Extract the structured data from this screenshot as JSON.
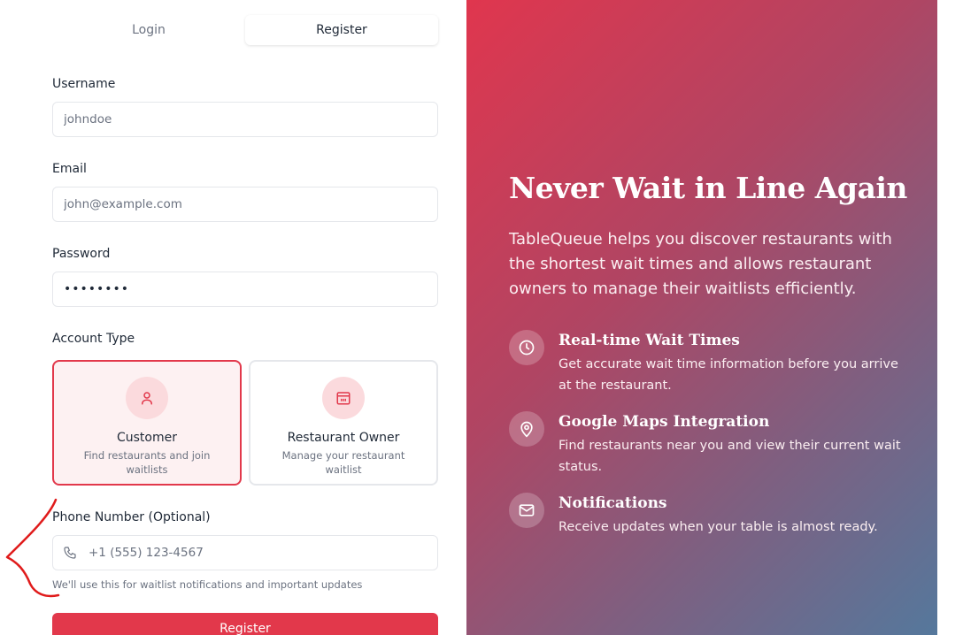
{
  "tabs": {
    "login": "Login",
    "register": "Register"
  },
  "form": {
    "username": {
      "label": "Username",
      "placeholder": "johndoe"
    },
    "email": {
      "label": "Email",
      "placeholder": "john@example.com"
    },
    "password": {
      "label": "Password",
      "value": "••••••••"
    },
    "account_type": {
      "label": "Account Type",
      "options": [
        {
          "title": "Customer",
          "description": "Find restaurants and join waitlists",
          "selected": true,
          "icon": "user-icon"
        },
        {
          "title": "Restaurant Owner",
          "description": "Manage your restaurant waitlist",
          "selected": false,
          "icon": "calendar-icon"
        }
      ]
    },
    "phone": {
      "label": "Phone Number (Optional)",
      "placeholder": "+1 (555) 123-4567",
      "hint": "We'll use this for waitlist notifications and important updates",
      "icon": "phone-icon"
    },
    "submit_label": "Register"
  },
  "hero": {
    "title": "Never Wait in Line Again",
    "subtitle": "TableQueue helps you discover restaurants with the shortest wait times and allows restaurant owners to manage their waitlists efficiently.",
    "features": [
      {
        "icon": "clock-icon",
        "title": "Real-time Wait Times",
        "description": "Get accurate wait time information before you arrive at the restaurant."
      },
      {
        "icon": "map-pin-icon",
        "title": "Google Maps Integration",
        "description": "Find restaurants near you and view their current wait status."
      },
      {
        "icon": "mail-icon",
        "title": "Notifications",
        "description": "Receive updates when your table is almost ready."
      }
    ]
  },
  "colors": {
    "accent": "#e2384b",
    "accent_light": "#fdf1f2",
    "gradient_start": "#e0364e",
    "gradient_end": "#55789c"
  }
}
